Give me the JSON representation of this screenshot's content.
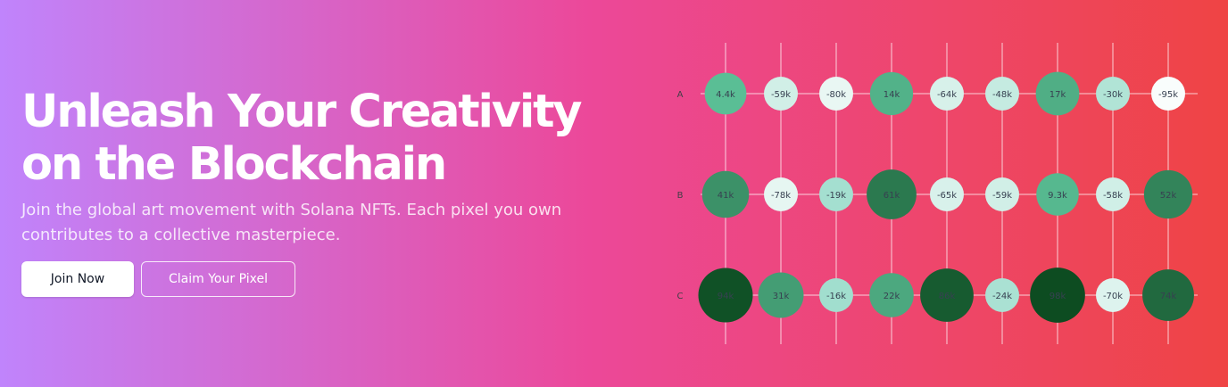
{
  "hero": {
    "headline_line1": "Unleash Your Creativity",
    "headline_line2": "on the Blockchain",
    "subtitle": "Join the global art movement with Solana NFTs. Each pixel you own contributes to a collective masterpiece.",
    "primary_button": "Join Now",
    "secondary_button": "Claim Your Pixel"
  },
  "colors": {
    "gradient_start": "#c084fc",
    "gradient_mid": "#ec4899",
    "gradient_end": "#ef4444",
    "positive_scale_light": "#5ec39a",
    "positive_scale_dark": "#0b4a1f",
    "negative_scale_light": "#ffffff",
    "negative_scale_dark": "#8fd8c5"
  },
  "pixel_grid": {
    "rows": [
      {
        "label": "A",
        "cells": [
          {
            "text": "4.4k",
            "value": 4400
          },
          {
            "text": "-59k",
            "value": -59000
          },
          {
            "text": "-80k",
            "value": -80000
          },
          {
            "text": "14k",
            "value": 14000
          },
          {
            "text": "-64k",
            "value": -64000
          },
          {
            "text": "-48k",
            "value": -48000
          },
          {
            "text": "17k",
            "value": 17000
          },
          {
            "text": "-30k",
            "value": -30000
          },
          {
            "text": "-95k",
            "value": -95000
          }
        ]
      },
      {
        "label": "B",
        "cells": [
          {
            "text": "41k",
            "value": 41000
          },
          {
            "text": "-78k",
            "value": -78000
          },
          {
            "text": "-19k",
            "value": -19000
          },
          {
            "text": "61k",
            "value": 61000
          },
          {
            "text": "-65k",
            "value": -65000
          },
          {
            "text": "-59k",
            "value": -59000
          },
          {
            "text": "9.3k",
            "value": 9300
          },
          {
            "text": "-58k",
            "value": -58000
          },
          {
            "text": "52k",
            "value": 52000
          }
        ]
      },
      {
        "label": "C",
        "cells": [
          {
            "text": "94k",
            "value": 94000
          },
          {
            "text": "31k",
            "value": 31000
          },
          {
            "text": "-16k",
            "value": -16000
          },
          {
            "text": "22k",
            "value": 22000
          },
          {
            "text": "86k",
            "value": 86000
          },
          {
            "text": "-24k",
            "value": -24000
          },
          {
            "text": "98k",
            "value": 98000
          },
          {
            "text": "-70k",
            "value": -70000
          },
          {
            "text": "74k",
            "value": 74000
          }
        ]
      }
    ]
  }
}
